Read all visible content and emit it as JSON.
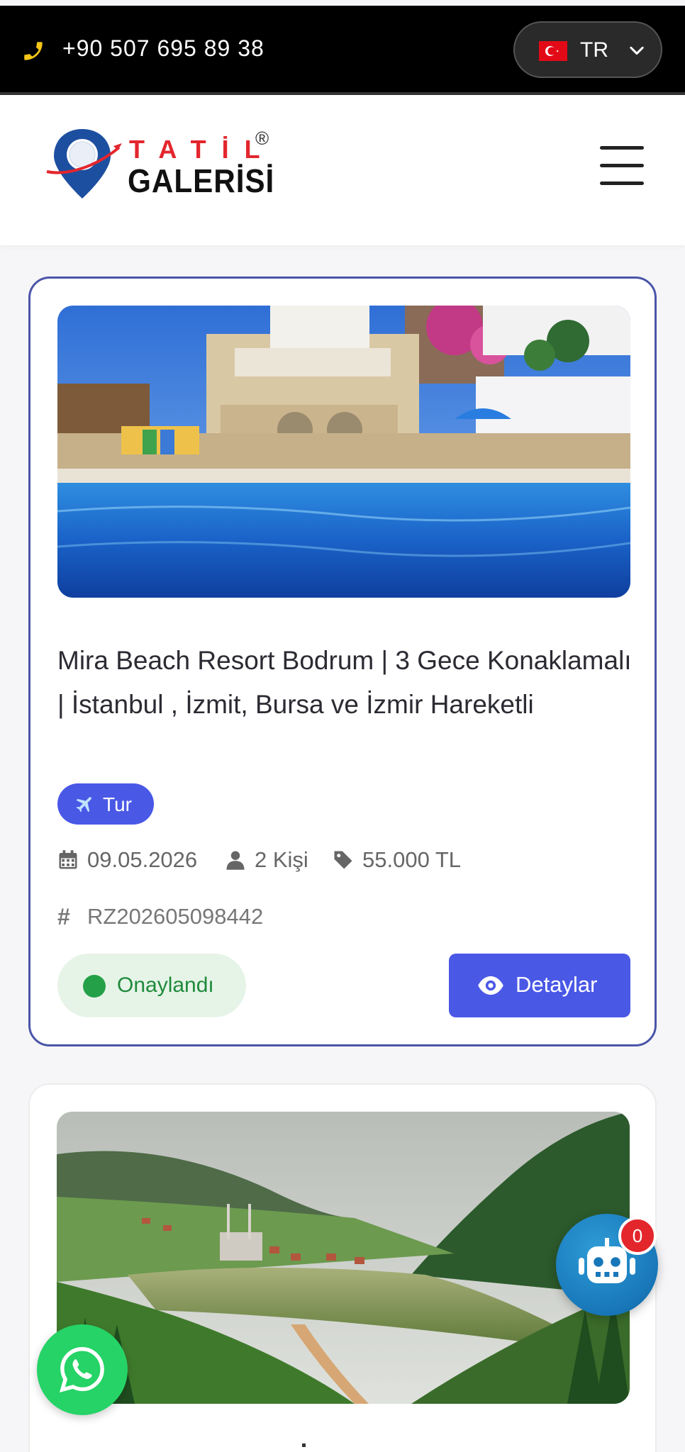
{
  "topbar": {
    "phone": "+90 507 695 89 38",
    "language": "TR",
    "flag_icon": "turkey-flag-icon"
  },
  "header": {
    "logo_line1": "TATİL",
    "logo_line2": "GALERİSİ",
    "logo_reg": "®",
    "menu_icon": "hamburger-menu-icon"
  },
  "reservations": [
    {
      "image": "resort pool with stone villas",
      "title": "Mira Beach Resort Bodrum | 3 Gece Konaklamalı | İstanbul , İzmit, Bursa ve İzmir Hareketli",
      "type_badge": "Tur",
      "type_icon": "airplane-icon",
      "date": "09.05.2026",
      "people": "2 Kişi",
      "price": "55.000 TL",
      "ref_code": "RZ202605098442",
      "status": "Onaylandı",
      "details_label": "Detaylar"
    },
    {
      "image": "mountain lake village with mosque"
    }
  ],
  "floating": {
    "whatsapp_icon": "whatsapp-icon",
    "chatbot_icon": "robot-icon",
    "chatbot_count": "0"
  },
  "colors": {
    "accent": "#4a58e6",
    "status_green": "#24a148",
    "brand_red": "#e3262c",
    "card_border": "#4a55a8"
  }
}
